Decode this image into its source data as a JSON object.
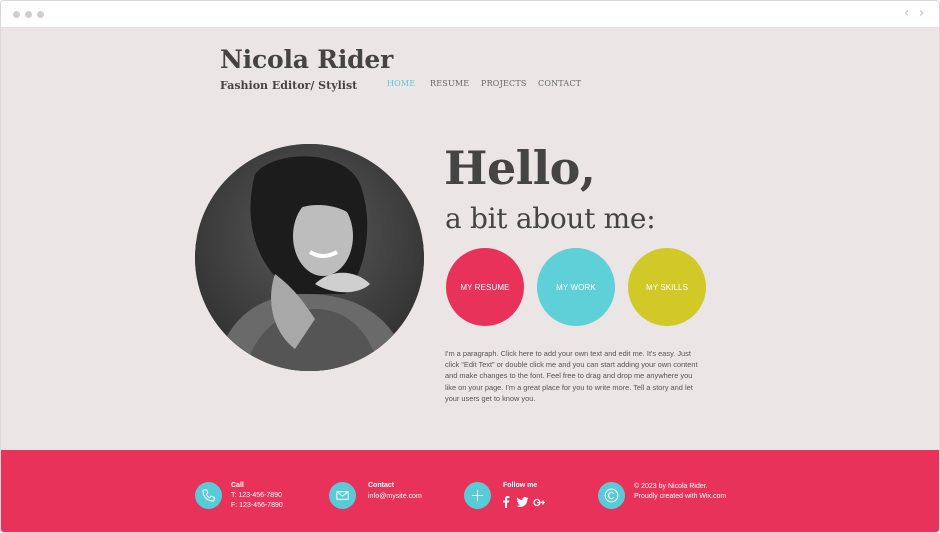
{
  "header": {
    "name": "Nicola Rider",
    "tagline": "Fashion Editor/ Stylist"
  },
  "nav": [
    {
      "label": "HOME",
      "active": true
    },
    {
      "label": "RESUME",
      "active": false
    },
    {
      "label": "PROJECTS",
      "active": false
    },
    {
      "label": "CONTACT",
      "active": false
    }
  ],
  "intro": {
    "hello": "Hello,",
    "about": "a bit about me:"
  },
  "buttons": [
    {
      "label": "MY RESUME",
      "color": "#e8325a"
    },
    {
      "label": "MY WORK",
      "color": "#5fcfd8"
    },
    {
      "label": "MY SKILLS",
      "color": "#d0c927"
    }
  ],
  "paragraph": "I'm a paragraph. Click here to add your own text and edit me. It's easy. Just click “Edit Text” or double click me and you can start adding your own content and make changes to the font. Feel free to drag and drop me anywhere you like on your page. I'm a great place for you to write more. Tell a story and let your users get to know you.",
  "footer": {
    "call": {
      "title": "Call",
      "tel": "T: 123-456-7890",
      "fax": "F: 123-456-7890",
      "icon": "phone-icon"
    },
    "contact": {
      "title": "Contact",
      "email": "info@mysite.com",
      "icon": "mail-icon"
    },
    "follow": {
      "title": "Follow me",
      "icon": "plus-icon",
      "networks": [
        "facebook-icon",
        "twitter-icon",
        "google-plus-icon"
      ]
    },
    "copyright": {
      "line1": "© 2023 by Nicola Rider.",
      "line2": "Proudly created with Wix.com",
      "icon": "copyright-icon"
    }
  },
  "colors": {
    "accent_red": "#e8325a",
    "accent_teal": "#58cbd6",
    "accent_yellow": "#d0c927",
    "background": "#ebe5e5",
    "text_dark": "#444444"
  }
}
